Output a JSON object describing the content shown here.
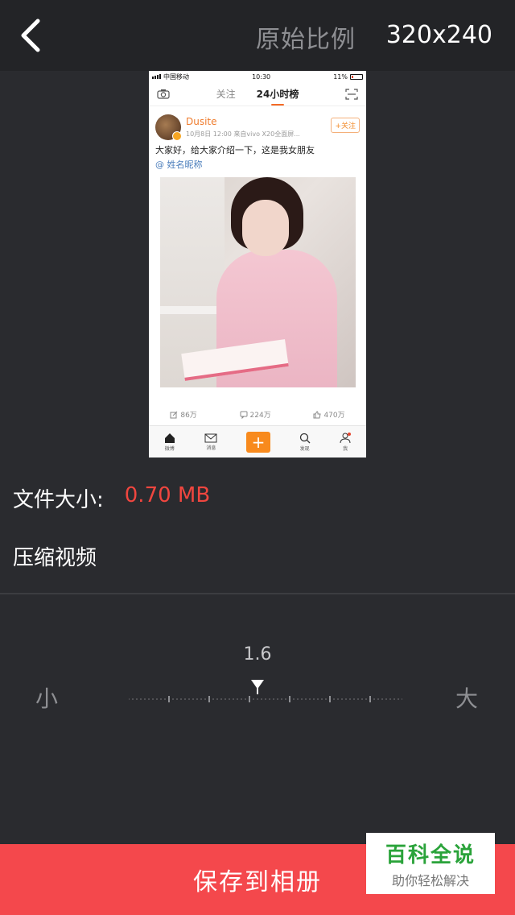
{
  "header": {
    "ratio_label": "原始比例",
    "resolution": "320x240"
  },
  "preview": {
    "status": {
      "carrier": "中国移动",
      "time": "10:30",
      "battery": "11%"
    },
    "nav": {
      "follow_tab": "关注",
      "hot_tab": "24小时榜"
    },
    "post": {
      "username": "Dusite",
      "meta": "10月8日 12:00  来自vivo X20全面屏...",
      "follow_button": "+关注",
      "text": "大家好，给大家介绍一下，这是我女朋友",
      "mention": "@ 姓名昵称"
    },
    "actions": {
      "repost": "86万",
      "comment": "224万",
      "like": "470万"
    },
    "tabbar": {
      "home": "微博",
      "message": "消息",
      "discover": "发现",
      "me": "我"
    }
  },
  "file_size": {
    "label": "文件大小:",
    "value": "0.70 MB"
  },
  "compress": {
    "label": "压缩视频"
  },
  "slider": {
    "value": "1.6",
    "min_label": "小",
    "max_label": "大",
    "level": 0.47
  },
  "save_button": {
    "label": "保存到相册"
  },
  "watermark": {
    "title": "百科全说",
    "subtitle": "助你轻松解决"
  },
  "colors": {
    "accent": "#f4484c",
    "size_value": "#f0463f",
    "background": "#2a2b2f",
    "topbar": "#232427"
  }
}
